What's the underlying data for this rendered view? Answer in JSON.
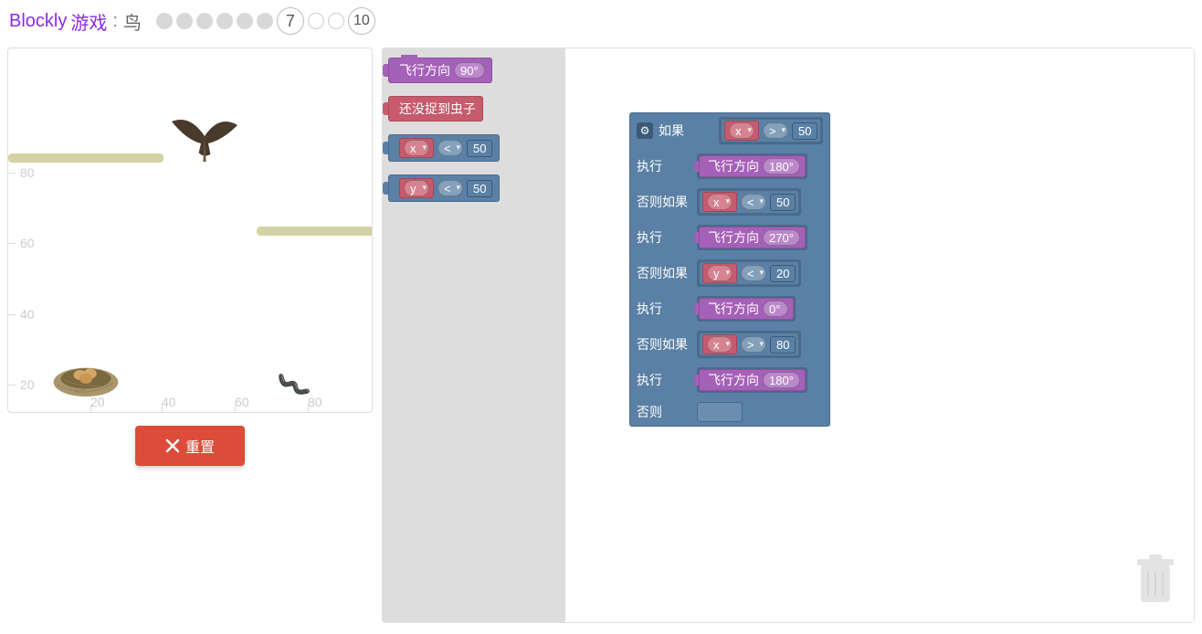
{
  "header": {
    "brand": "Blockly",
    "brand_suffix": "游戏",
    "sep1": " : ",
    "game_name": "鸟",
    "current_level": "7",
    "final_level": "10"
  },
  "canvas": {
    "axis": {
      "20": "20",
      "40": "40",
      "60": "60",
      "80": "80"
    }
  },
  "buttons": {
    "reset": "重置"
  },
  "toolbox": {
    "heading_label": "飞行方向",
    "heading_angle": "90°",
    "no_worm": "还没捉到虫子",
    "cmp1_var": "x",
    "cmp1_op": "<",
    "cmp1_val": "50",
    "cmp2_var": "y",
    "cmp2_op": "<",
    "cmp2_val": "50"
  },
  "program": {
    "if_label": "如果",
    "do_label": "执行",
    "elseif_label": "否则如果",
    "else_label": "否则",
    "r1_var": "x",
    "r1_op": ">",
    "r1_val": "50",
    "h1_label": "飞行方向",
    "h1_angle": "180°",
    "r2_var": "x",
    "r2_op": "<",
    "r2_val": "50",
    "h2_label": "飞行方向",
    "h2_angle": "270°",
    "r3_var": "y",
    "r3_op": "<",
    "r3_val": "20",
    "h3_label": "飞行方向",
    "h3_angle": "0°",
    "r4_var": "x",
    "r4_op": ">",
    "r4_val": "80",
    "h4_label": "飞行方向",
    "h4_angle": "180°"
  }
}
